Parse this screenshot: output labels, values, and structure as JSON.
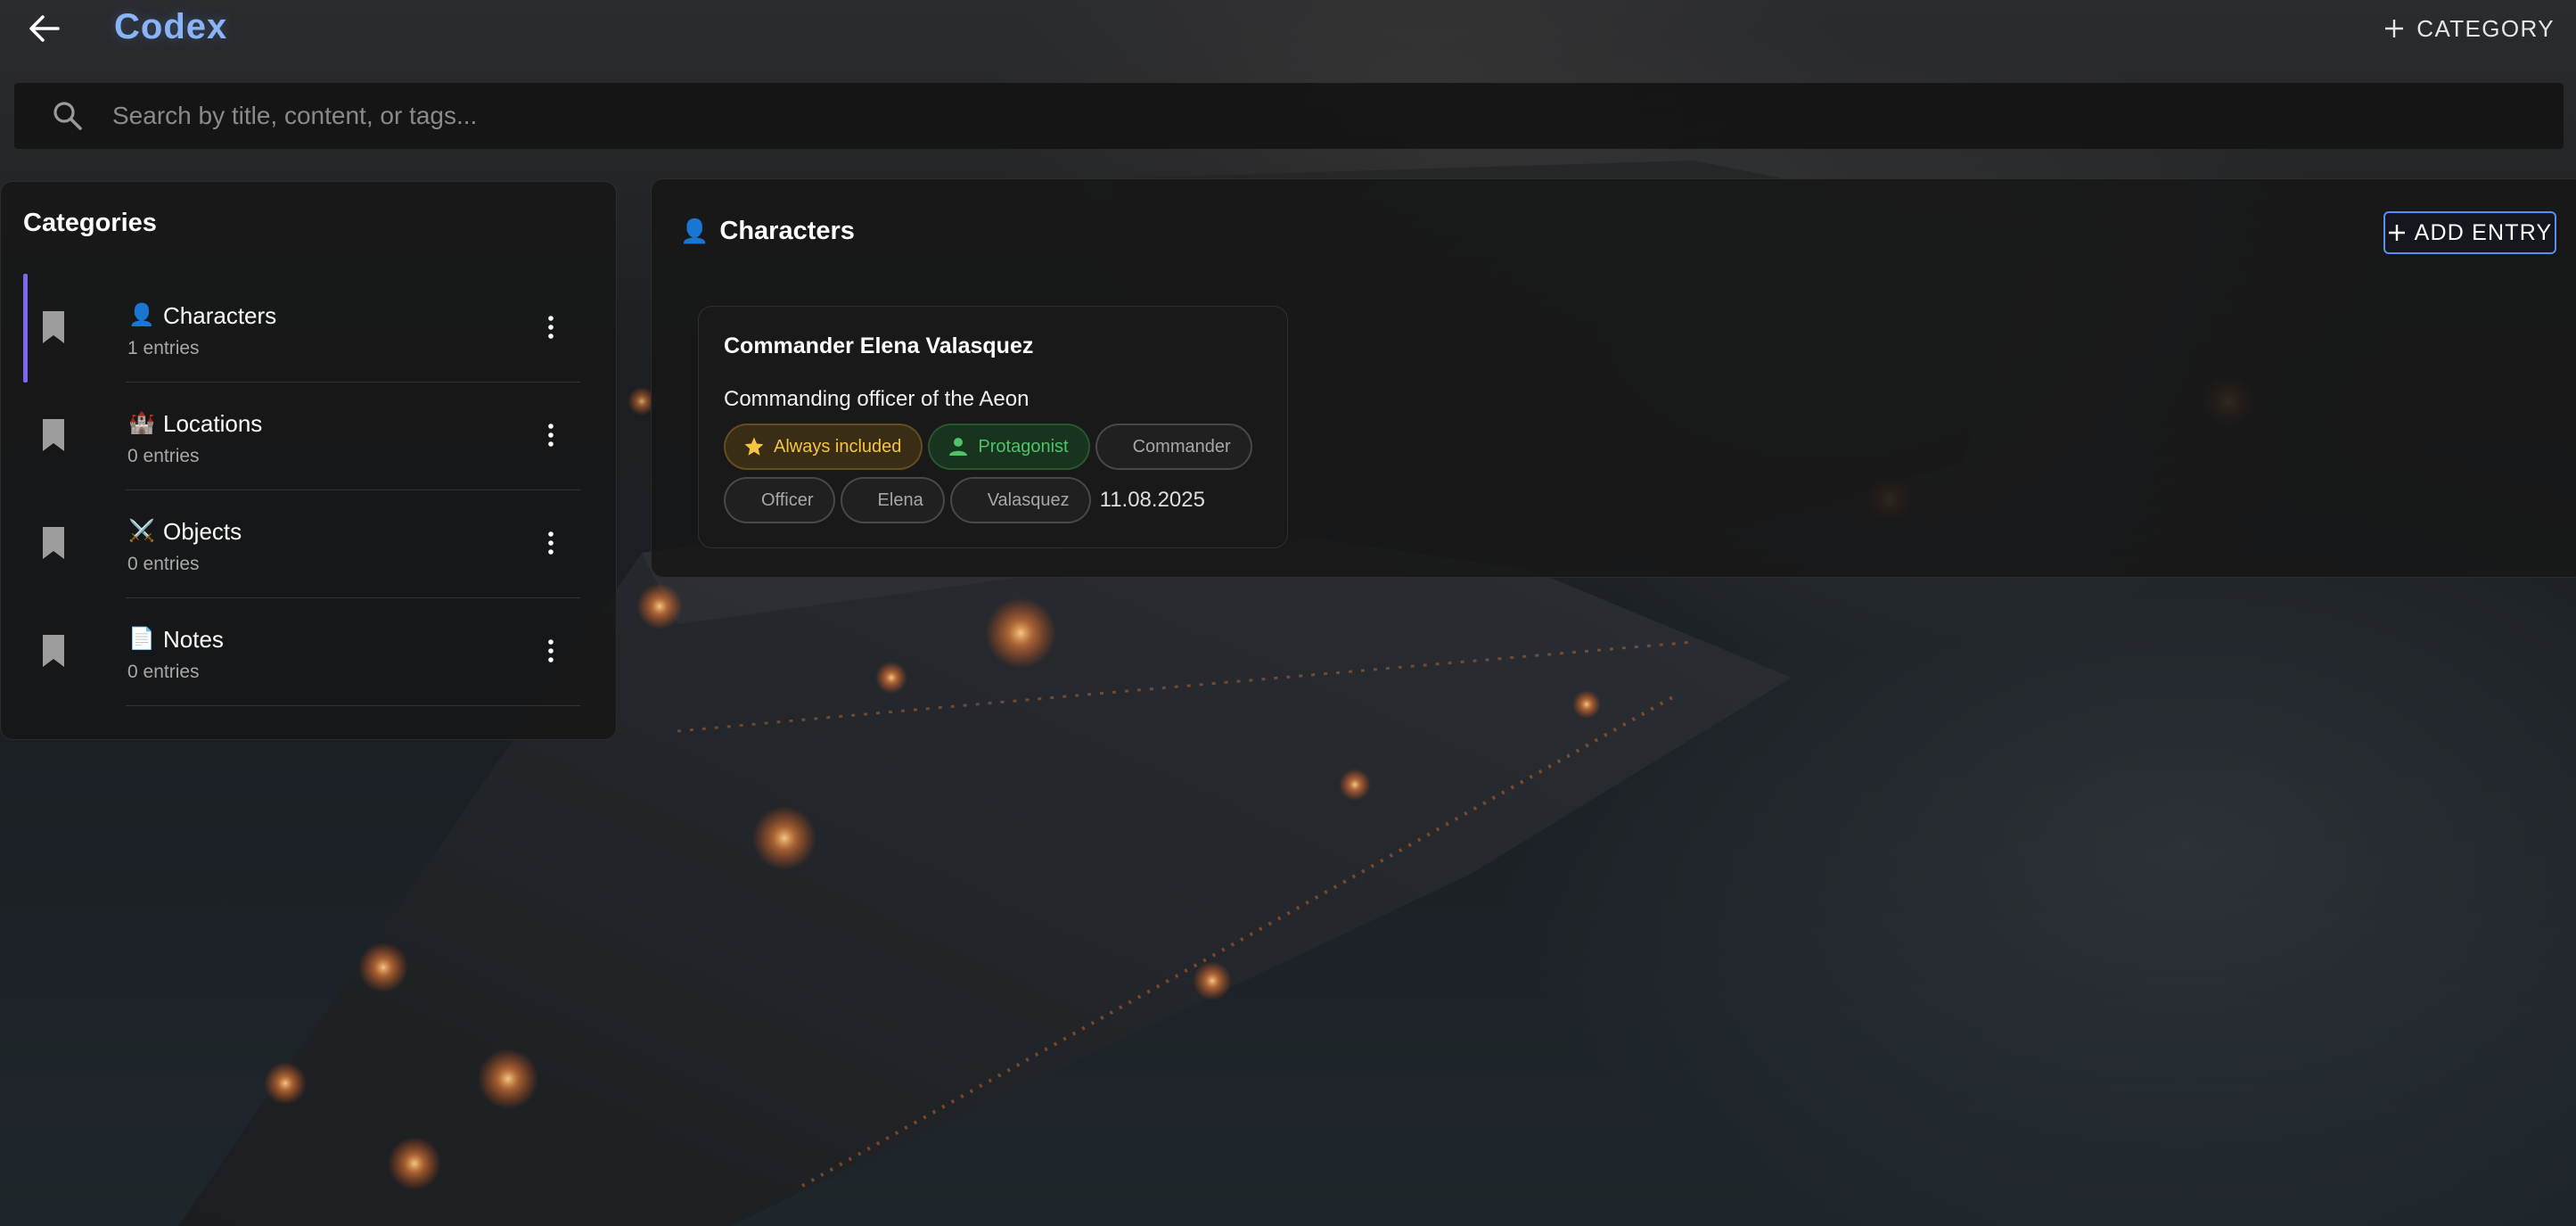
{
  "header": {
    "back_icon": "arrow-left-icon",
    "title": "Codex",
    "add_category_label": "CATEGORY",
    "add_category_icon": "plus-icon"
  },
  "search": {
    "placeholder": "Search by title, content, or tags...",
    "value": "",
    "icon": "search-icon"
  },
  "categories": {
    "heading": "Categories",
    "items": [
      {
        "emoji": "👤",
        "name": "Characters",
        "count": "1 entries",
        "active": true
      },
      {
        "emoji": "🏰",
        "name": "Locations",
        "count": "0 entries",
        "active": false
      },
      {
        "emoji": "⚔️",
        "name": "Objects",
        "count": "0 entries",
        "active": false
      },
      {
        "emoji": "📄",
        "name": "Notes",
        "count": "0 entries",
        "active": false
      }
    ]
  },
  "main": {
    "category_emoji": "👤",
    "category_title": "Characters",
    "add_entry_label": "ADD ENTRY",
    "entries": [
      {
        "title": "Commander Elena Valasquez",
        "description": "Commanding officer of the Aeon",
        "badges": {
          "always_included": "Always included",
          "role": "Protagonist"
        },
        "tags": [
          "Commander",
          "Officer",
          "Elena",
          "Valasquez"
        ],
        "date": "11.08.2025"
      }
    ]
  },
  "colors": {
    "title_blue": "#8ab4f8",
    "accent_purple": "#7c68ee",
    "button_border": "#5a8df5",
    "gold": "#f4c542",
    "green": "#4fc36a"
  }
}
